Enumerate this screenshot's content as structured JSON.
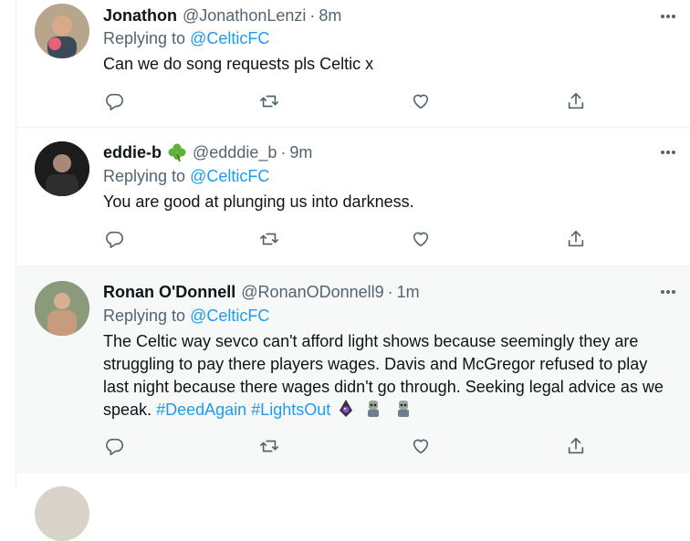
{
  "tweets": [
    {
      "name": "Jonathon",
      "handle": "@JonathonLenzi",
      "time": "8m",
      "replying_label": "Replying to",
      "replying_to": "@CelticFC",
      "text": "Can we do song requests pls Celtic x",
      "badge": ""
    },
    {
      "name": "eddie-b",
      "handle": "@edddie_b",
      "time": "9m",
      "replying_label": "Replying to",
      "replying_to": "@CelticFC",
      "text": "You are good at plunging us into darkness.",
      "badge": "shamrock-icon"
    },
    {
      "name": "Ronan O'Donnell",
      "handle": "@RonanODonnell9",
      "time": "1m",
      "replying_label": "Replying to",
      "replying_to": "@CelticFC",
      "text": "The Celtic way sevco can't afford light shows because seemingly they are struggling to pay there players wages. Davis and McGregor refused to play last night because there wages didn't go through. Seeking legal advice as we speak.",
      "hashtags": [
        "#DeedAgain",
        "#LightsOut"
      ],
      "emojis": [
        "crystal-ball-icon",
        "zombie-icon",
        "zombie-icon"
      ]
    }
  ],
  "dot": "·",
  "colors": {
    "link": "#1d9bf0",
    "secondary": "#536471",
    "highlight_bg": "#f7f9f9"
  },
  "icons": [
    "reply-icon",
    "retweet-icon",
    "like-icon",
    "share-icon",
    "more-icon"
  ]
}
